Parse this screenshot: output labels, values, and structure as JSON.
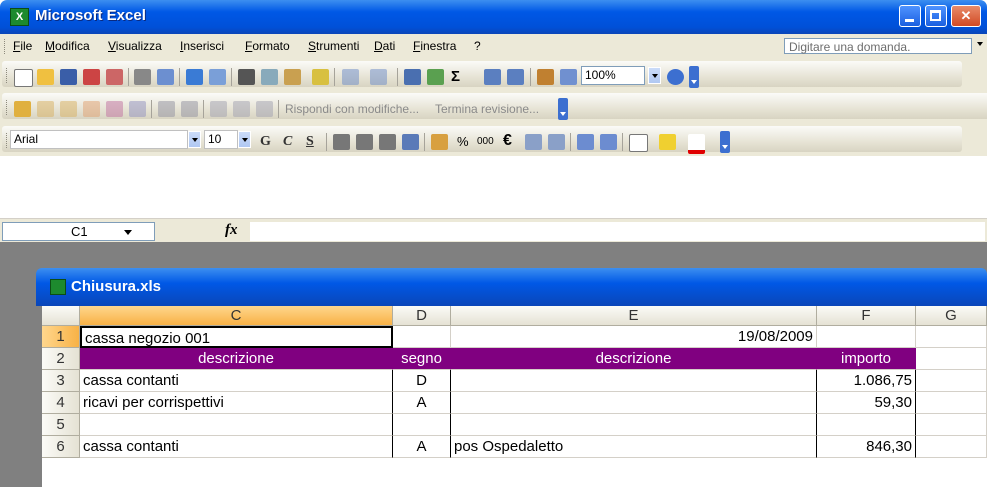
{
  "app": {
    "title": "Microsoft Excel"
  },
  "menu": {
    "items": [
      "File",
      "Modifica",
      "Visualizza",
      "Inserisci",
      "Formato",
      "Strumenti",
      "Dati",
      "Finestra",
      "?"
    ],
    "ask_placeholder": "Digitare una domanda."
  },
  "toolbar_standard": {
    "zoom": "100%"
  },
  "toolbar_review": {
    "reply": "Rispondi con modifiche...",
    "end_review": "Termina revisione..."
  },
  "toolbar_format": {
    "font": "Arial",
    "size": "10",
    "bold": "G",
    "italic": "C",
    "underline": "S",
    "percent": "%",
    "thousands": "000",
    "euro": "€"
  },
  "formula_bar": {
    "cell_ref": "C1",
    "fx": "fx",
    "content": ""
  },
  "workbook": {
    "name": "Chiusura.xls"
  },
  "sheet": {
    "columns": [
      "C",
      "D",
      "E",
      "F",
      "G"
    ],
    "rows": [
      {
        "n": "1",
        "c": "cassa negozio 001",
        "d": "",
        "e": "19/08/2009",
        "f": ""
      },
      {
        "n": "2",
        "c": "descrizione",
        "d": "segno",
        "e": "descrizione",
        "f": "importo"
      },
      {
        "n": "3",
        "c": "cassa contanti",
        "d": "D",
        "e": "",
        "f": "1.086,75"
      },
      {
        "n": "4",
        "c": "ricavi per corrispettivi",
        "d": "A",
        "e": "",
        "f": "59,30"
      },
      {
        "n": "5",
        "c": "",
        "d": "",
        "e": "",
        "f": ""
      },
      {
        "n": "6",
        "c": "cassa contanti",
        "d": "A",
        "e": "pos Ospedaletto",
        "f": "846,30"
      }
    ]
  },
  "colors": {
    "header_purple": "#800080",
    "selected_header": "#f8b246",
    "title_blue": "#0058e6"
  }
}
